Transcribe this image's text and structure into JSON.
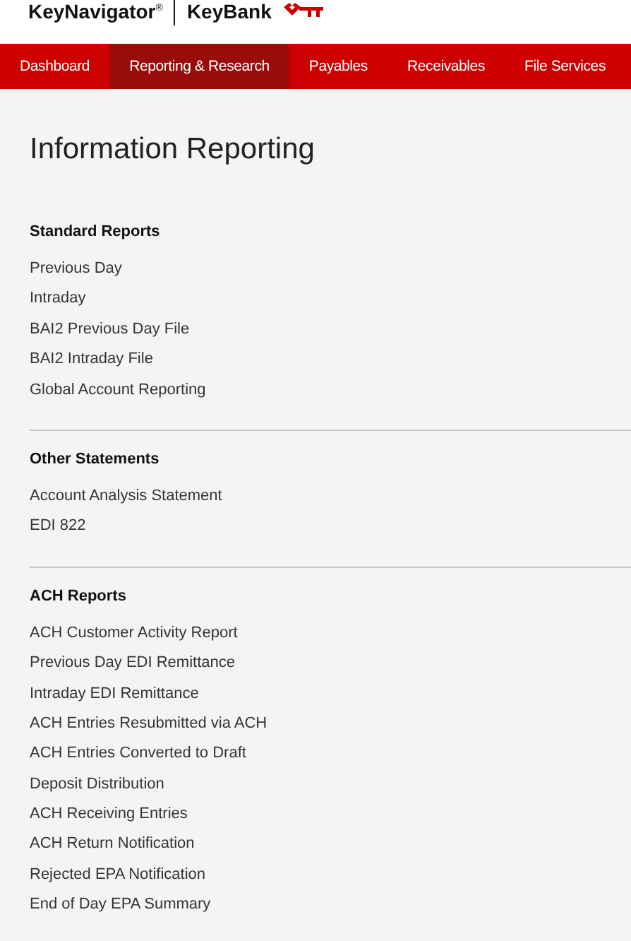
{
  "brand": {
    "product": "KeyNavigator$^{®}$",
    "bank": "KeyBank"
  },
  "nav": [
    {
      "label": "Dashboard",
      "selected": false
    },
    {
      "label": "Reporting & Research",
      "selected": true
    },
    {
      "label": "Payables",
      "selected": false
    },
    {
      "label": "Receivables",
      "selected": false
    },
    {
      "label": "File Services",
      "selected": false
    }
  ],
  "page_title": "Information Reporting",
  "sections": [
    {
      "heading": "Standard Reports",
      "links": [
        "Previous Day",
        "Intraday",
        "BAI2 Previous Day File",
        "BAI2 Intraday File",
        "Global Account Reporting"
      ]
    },
    {
      "heading": "Other Statements",
      "links": [
        "Account Analysis Statement",
        "EDI 822"
      ]
    },
    {
      "heading": "ACH Reports",
      "links": [
        "ACH Customer Activity Report",
        "Previous Day EDI Remittance",
        "Intraday EDI Remittance",
        "ACH Entries Resubmitted via ACH",
        "ACH Entries Converted to Draft",
        "Deposit Distribution",
        "ACH Receiving Entries",
        "ACH Return Notification",
        "Rejected EPA Notification",
        "End of Day EPA Summary"
      ]
    }
  ]
}
